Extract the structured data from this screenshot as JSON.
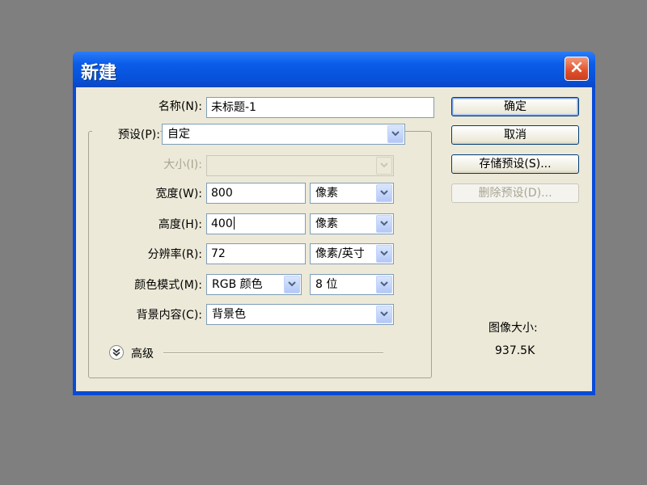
{
  "dialog": {
    "title": "新建",
    "close_symbol": "×"
  },
  "fields": {
    "name": {
      "label": "名称(N):",
      "value": "未标题-1"
    },
    "preset": {
      "label": "预设(P):",
      "value": "自定"
    },
    "size": {
      "label": "大小(I):",
      "value": ""
    },
    "width": {
      "label": "宽度(W):",
      "value": "800",
      "unit": "像素"
    },
    "height": {
      "label": "高度(H):",
      "value": "400",
      "unit": "像素"
    },
    "resolution": {
      "label": "分辨率(R):",
      "value": "72",
      "unit": "像素/英寸"
    },
    "color_mode": {
      "label": "颜色模式(M):",
      "value": "RGB 颜色",
      "depth": "8 位"
    },
    "background": {
      "label": "背景内容(C):",
      "value": "背景色"
    }
  },
  "advanced": {
    "label": "高级"
  },
  "buttons": {
    "ok": "确定",
    "cancel": "取消",
    "save_preset": "存储预设(S)...",
    "delete_preset": "删除预设(D)..."
  },
  "image_size": {
    "label": "图像大小:",
    "value": "937.5K"
  },
  "colors": {
    "title_bar": "#0a5ce8",
    "close_button": "#e0502a",
    "dialog_bg": "#ece9d8"
  }
}
